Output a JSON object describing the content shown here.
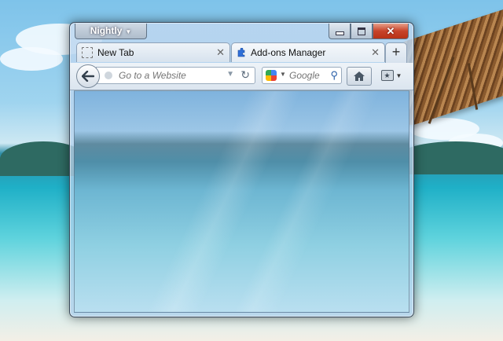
{
  "window": {
    "app_menu_label": "Nightly",
    "tabs": [
      {
        "label": "New Tab",
        "favicon": "blank-page-icon"
      },
      {
        "label": "Add-ons Manager",
        "favicon": "puzzle-piece-icon"
      }
    ],
    "new_tab_label": "+",
    "url_placeholder": "Go to a Website",
    "search_engine": "Google",
    "search_placeholder": "Google"
  },
  "colors": {
    "close_button": "#c7432a",
    "chrome": "#dbe5ef",
    "accent": "#2a5fa8"
  }
}
